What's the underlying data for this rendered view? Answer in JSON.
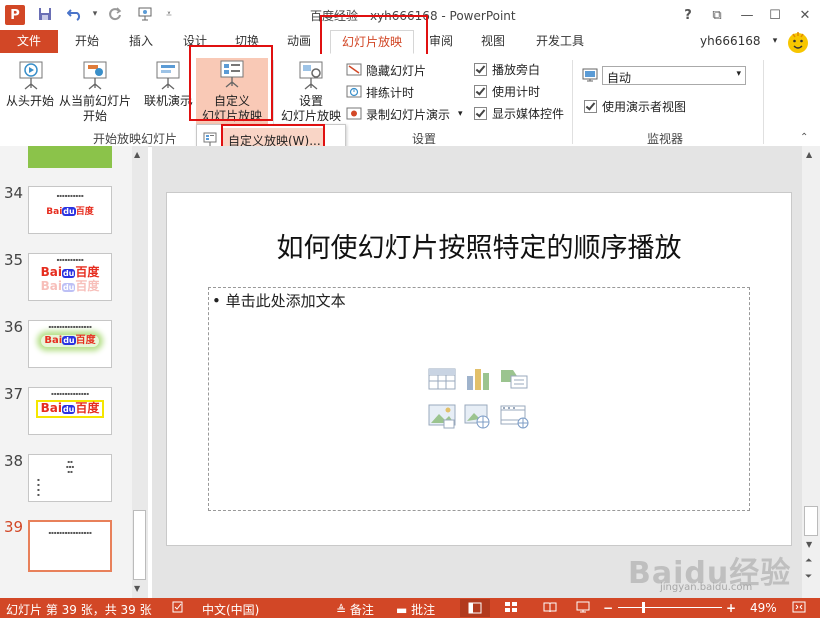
{
  "app": {
    "logo_letter": "P",
    "title": "百度经验 - xyh666168 - PowerPoint"
  },
  "window_controls": {
    "help": "?",
    "restore_ribbon": "⧉",
    "minimize": "—",
    "maximize": "☐",
    "close": "✕"
  },
  "tabs": [
    {
      "label": "文件"
    },
    {
      "label": "开始"
    },
    {
      "label": "插入"
    },
    {
      "label": "设计"
    },
    {
      "label": "切换"
    },
    {
      "label": "动画"
    },
    {
      "label": "幻灯片放映"
    },
    {
      "label": "审阅"
    },
    {
      "label": "视图"
    },
    {
      "label": "开发工具"
    }
  ],
  "account": {
    "name": "yh666168",
    "arrow": "▾"
  },
  "ribbon": {
    "from_beginning": "从头开始",
    "from_current_line1": "从当前幻灯片",
    "from_current_line2": "开始",
    "online_present": "联机演示",
    "custom_line1": "自定义",
    "custom_line2": "幻灯片放映",
    "setup_line1": "设置",
    "setup_line2": "幻灯片放映",
    "hide_slide": "隐藏幻灯片",
    "rehearse": "排练计时",
    "record": "录制幻灯片演示",
    "play_narration": "播放旁白",
    "use_timings": "使用计时",
    "show_media_controls": "显示媒体控件",
    "monitor_value": "自动",
    "presenter_view": "使用演示者视图",
    "group_start": "开始放映幻灯片",
    "group_setup": "设置",
    "group_monitor": "监视器"
  },
  "dropdown": {
    "item": "自定义放映(W)..."
  },
  "thumbnails": [
    {
      "num": "34"
    },
    {
      "num": "35"
    },
    {
      "num": "36"
    },
    {
      "num": "37"
    },
    {
      "num": "38"
    },
    {
      "num": "39"
    }
  ],
  "slide": {
    "title": "如何使幻灯片按照特定的顺序播放",
    "placeholder": "单击此处添加文本"
  },
  "status": {
    "slide_info": "幻灯片 第 39 张，共 39 张",
    "language": "中文(中国)",
    "notes": "备注",
    "comments": "批注",
    "zoom": "49%"
  },
  "watermark": {
    "text": "Baidu经验",
    "url": "jingyan.baidu.com"
  },
  "colors": {
    "accent": "#d24726",
    "highlight": "#e01010",
    "selected_btn": "#f9c9b6"
  }
}
